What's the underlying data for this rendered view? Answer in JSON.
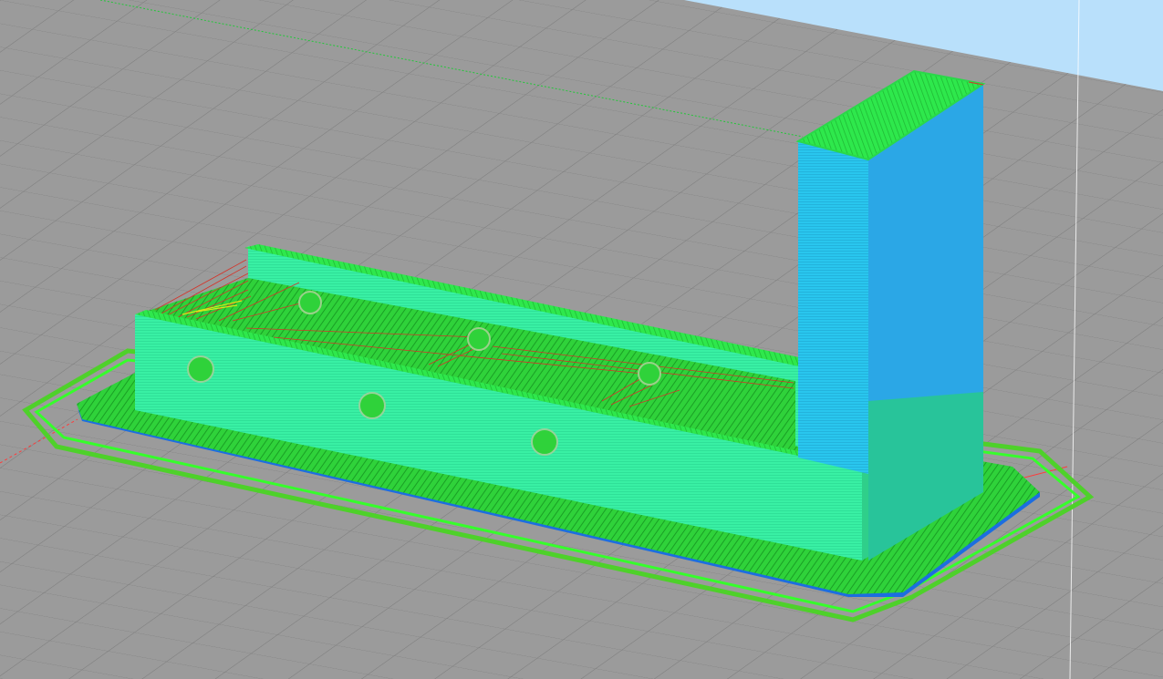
{
  "viewport": {
    "view": "3d-gcode-preview",
    "colors": {
      "sky": "#b9e0fb",
      "bed_plate": "#9b9b9b",
      "bed_grid": "#7a7a7a",
      "skirt_outer": "#4ed12a",
      "skirt_inner": "#36ff2b",
      "brim_fill": "#2fd23a",
      "first_layer_edge": "#1c6ee0",
      "wall_face": "#39f0a4",
      "wall_top": "#2ee84c",
      "tower_face": "#29c6ee",
      "tower_side": "#2ba7e6",
      "travel_moves": "#d4342a",
      "retraction": "#d9e61a",
      "axis_x": "#ff3b3b",
      "axis_y": "#24c63a",
      "axis_z": "#ffffff"
    }
  }
}
